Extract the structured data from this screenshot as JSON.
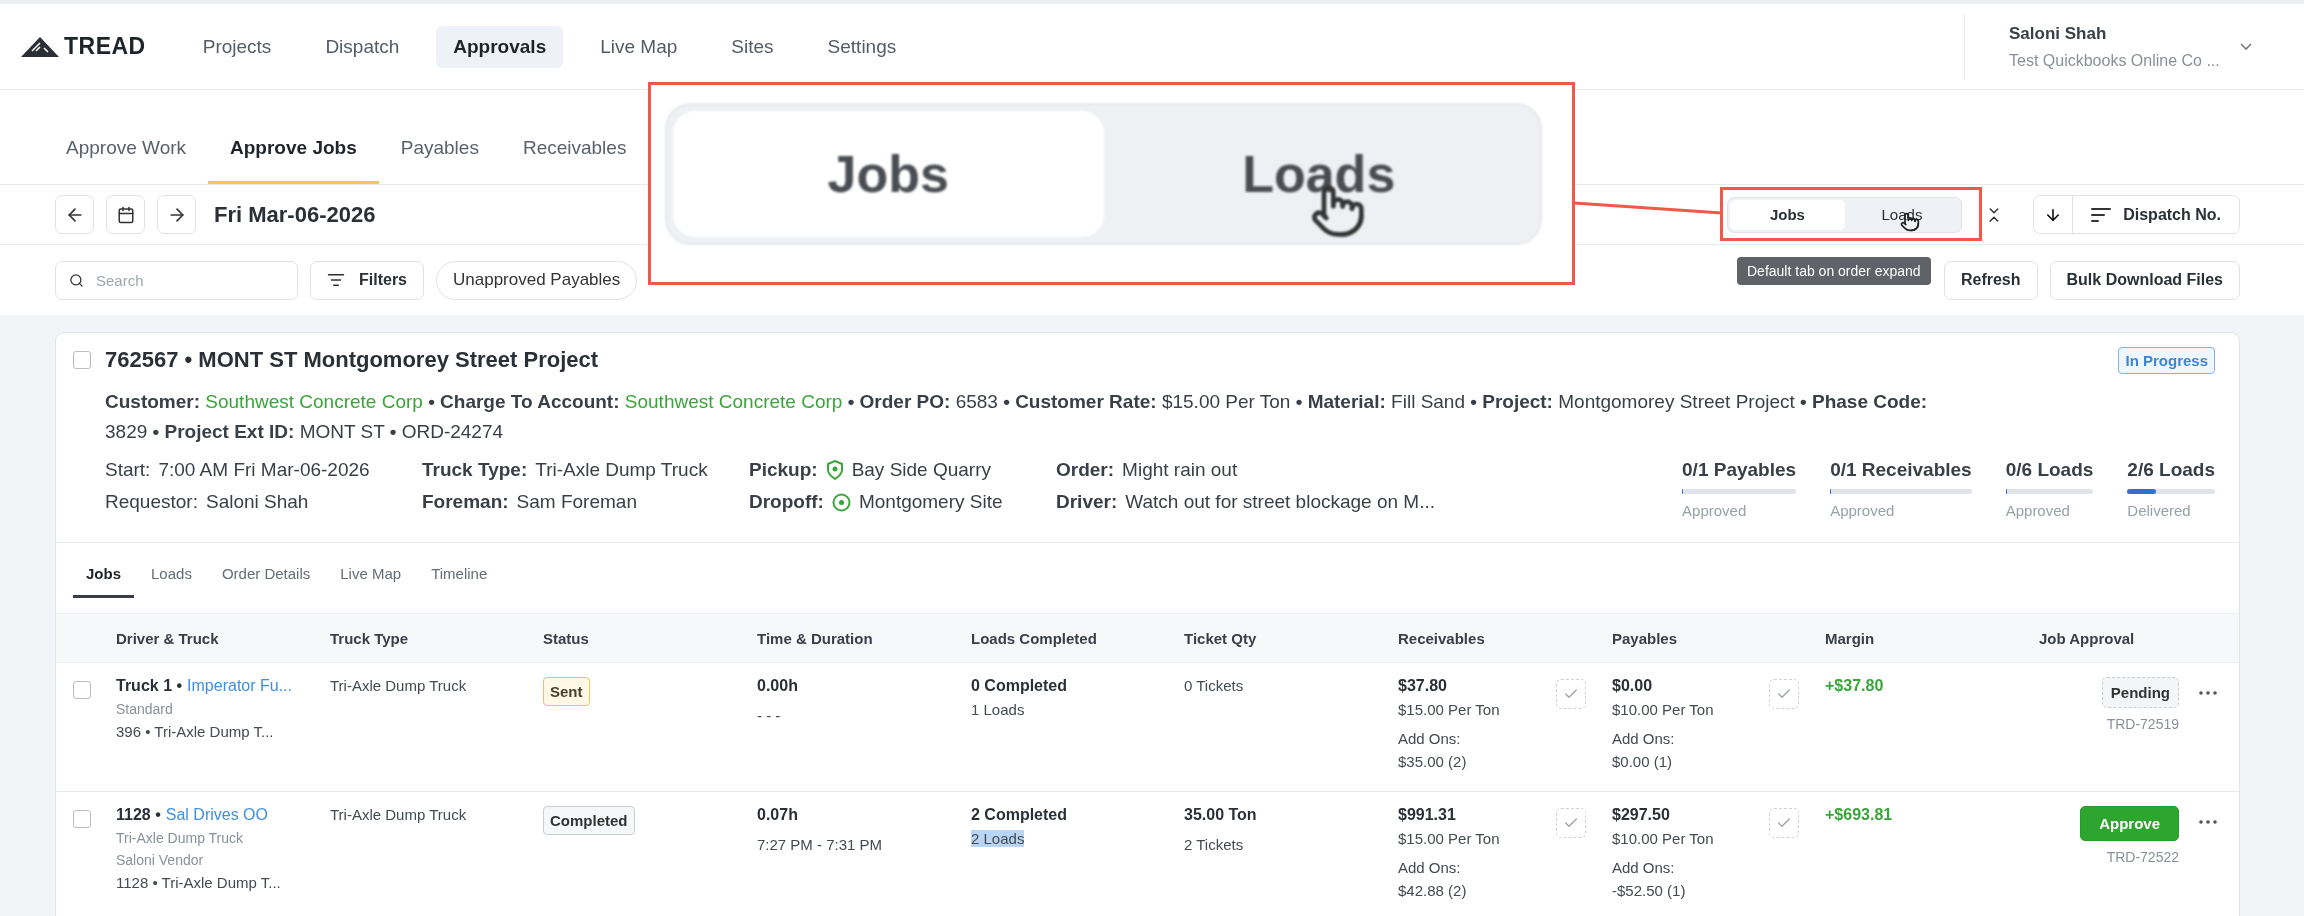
{
  "logo": {
    "text": "TREAD"
  },
  "nav": [
    {
      "label": "Projects",
      "selected": false
    },
    {
      "label": "Dispatch",
      "selected": false
    },
    {
      "label": "Approvals",
      "selected": true
    },
    {
      "label": "Live Map",
      "selected": false
    },
    {
      "label": "Sites",
      "selected": false
    },
    {
      "label": "Settings",
      "selected": false
    }
  ],
  "user": {
    "name": "Saloni Shah",
    "company": "Test Quickbooks Online Co ..."
  },
  "subtabs": [
    {
      "label": "Approve Work",
      "selected": false
    },
    {
      "label": "Approve Jobs",
      "selected": true
    },
    {
      "label": "Payables",
      "selected": false
    },
    {
      "label": "Receivables",
      "selected": false
    }
  ],
  "date": "Fri Mar-06-2026",
  "view_toggle": [
    {
      "label": "Jobs",
      "selected": true
    },
    {
      "label": "Loads",
      "selected": false
    }
  ],
  "sort": {
    "label": "Dispatch No."
  },
  "search": {
    "placeholder": "Search"
  },
  "filters_button": "Filters",
  "chips": [
    {
      "label": "Unapproved Payables"
    }
  ],
  "refresh_button": "Refresh",
  "bulk_button": "Bulk Download Files",
  "tooltip": "Default tab on order expand",
  "callout": {
    "tabs": [
      {
        "label": "Jobs",
        "selected": true
      },
      {
        "label": "Loads",
        "selected": false
      }
    ]
  },
  "order": {
    "checked": false,
    "title": "762567 • MONT ST Montgomorey Street Project",
    "status": "In Progress",
    "summary": [
      {
        "text": "Customer:",
        "kind": "label"
      },
      {
        "text": "Southwest Concrete Corp",
        "kind": "link"
      },
      {
        "text": "• Charge To Account:",
        "kind": "label"
      },
      {
        "text": "Southwest Concrete Corp",
        "kind": "link"
      },
      {
        "text": "• Order PO:",
        "kind": "label"
      },
      {
        "text": "6583",
        "kind": "plain"
      },
      {
        "text": "• Customer Rate:",
        "kind": "label"
      },
      {
        "text": "$15.00 Per Ton",
        "kind": "plain"
      },
      {
        "text": "• Material:",
        "kind": "label"
      },
      {
        "text": "Fill Sand",
        "kind": "plain"
      },
      {
        "text": "• Project:",
        "kind": "label"
      },
      {
        "text": "Montgomorey Street Project",
        "kind": "plain"
      },
      {
        "text": "• Phase Code:",
        "kind": "label"
      },
      {
        "text": "3829",
        "kind": "plain"
      },
      {
        "text": "• Project Ext ID:",
        "kind": "label"
      },
      {
        "text": "MONT ST",
        "kind": "plain"
      },
      {
        "text": "•",
        "kind": "label"
      },
      {
        "text": "ORD-24274",
        "kind": "plain"
      }
    ],
    "details": [
      [
        {
          "label": "Start:",
          "value": "7:00 AM Fri Mar-06-2026",
          "kind": "text"
        },
        {
          "label": "Requestor:",
          "value": "Saloni Shah",
          "kind": "text"
        }
      ],
      [
        {
          "label": "Truck Type:",
          "value": "Tri-Axle Dump Truck",
          "kind": "text"
        },
        {
          "label": "Foreman:",
          "value": "Sam Foreman",
          "kind": "text"
        }
      ],
      [
        {
          "label": "Pickup:",
          "value": "Bay Side Quarry",
          "kind": "pickup"
        },
        {
          "label": "Dropoff:",
          "value": "Montgomery Site",
          "kind": "dropoff"
        }
      ],
      [
        {
          "label": "Order:",
          "value": "Might rain out",
          "kind": "text"
        },
        {
          "label": "Driver:",
          "value": "Watch out for street blockage on M...",
          "kind": "text"
        }
      ]
    ],
    "stats": [
      {
        "value": "0/1 Payables",
        "level": 0,
        "caption": "Approved"
      },
      {
        "value": "0/1 Receivables",
        "level": 0,
        "caption": "Approved"
      },
      {
        "value": "0/6 Loads",
        "level": 0,
        "caption": "Approved"
      },
      {
        "value": "2/6 Loads",
        "level": 0.33,
        "caption": "Delivered"
      }
    ]
  },
  "inner_tabs": [
    {
      "label": "Jobs",
      "selected": true
    },
    {
      "label": "Loads",
      "selected": false
    },
    {
      "label": "Order Details",
      "selected": false
    },
    {
      "label": "Live Map",
      "selected": false
    },
    {
      "label": "Timeline",
      "selected": false
    }
  ],
  "table": {
    "columns": [
      "Driver & Truck",
      "Truck Type",
      "Status",
      "Time & Duration",
      "Loads Completed",
      "Ticket Qty",
      "Receivables",
      "Payables",
      "Margin",
      "Job Approval"
    ],
    "rows": [
      {
        "checked": false,
        "driver": {
          "unit": "Truck 1 •",
          "company": "Imperator Fu...",
          "lines": [
            "Standard"
          ],
          "vehicle": "396 • Tri-Axle Dump T..."
        },
        "truck_type": "Tri-Axle Dump Truck",
        "status": {
          "label": "Sent",
          "kind": "sent"
        },
        "time": {
          "duration": "0.00h",
          "range": "- - -"
        },
        "loads": {
          "completed": "0 Completed",
          "count": "1 Loads",
          "highlighted": false
        },
        "tickets": {
          "count": "0 Tickets"
        },
        "receivables": {
          "total": "$37.80",
          "rate": "$15.00 Per Ton",
          "addons_label": "Add Ons:",
          "addons": "$35.00 (2)"
        },
        "payables": {
          "total": "$0.00",
          "rate": "$10.00 Per Ton",
          "addons_label": "Add Ons:",
          "addons": "$0.00 (1)"
        },
        "margin": "+$37.80",
        "approval": {
          "label": "Pending",
          "kind": "pending",
          "ticket": "TRD-72519"
        }
      },
      {
        "checked": false,
        "driver": {
          "unit": "1128 •",
          "company": "Sal Drives OO",
          "lines": [
            "Tri-Axle Dump Truck",
            "Saloni Vendor"
          ],
          "vehicle": "1128 • Tri-Axle Dump T..."
        },
        "truck_type": "Tri-Axle Dump Truck",
        "status": {
          "label": "Completed",
          "kind": "completed"
        },
        "time": {
          "duration": "0.07h",
          "range": "7:27 PM - 7:31 PM"
        },
        "loads": {
          "completed": "2 Completed",
          "count": "2 Loads",
          "highlighted": true
        },
        "tickets": {
          "qty": "35.00 Ton",
          "count": "2 Tickets"
        },
        "receivables": {
          "total": "$991.31",
          "rate": "$15.00 Per Ton",
          "addons_label": "Add Ons:",
          "addons": "$42.88 (2)"
        },
        "payables": {
          "total": "$297.50",
          "rate": "$10.00 Per Ton",
          "addons_label": "Add Ons:",
          "addons": "-$52.50 (1)"
        },
        "margin": "+$693.81",
        "approval": {
          "label": "Approve",
          "kind": "approve",
          "ticket": "TRD-72522"
        }
      }
    ]
  }
}
